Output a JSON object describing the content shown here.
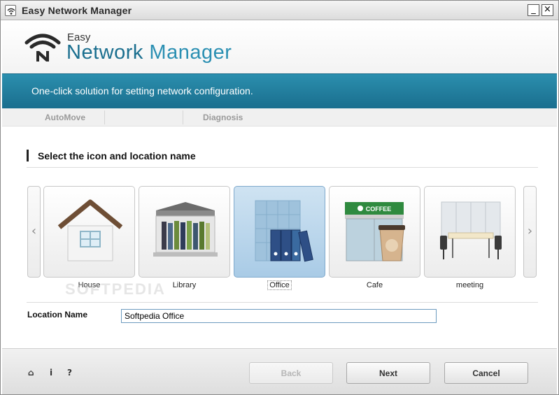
{
  "window": {
    "title": "Easy Network Manager",
    "minimize_glyph": "_",
    "close_glyph": "×",
    "icon": "wifi-icon"
  },
  "header": {
    "logo_small": "Easy",
    "logo_big_1": "Network",
    "logo_big_2": "Manager"
  },
  "banner": {
    "text": "One-click solution for setting network configuration."
  },
  "tabs": [
    {
      "label": "AutoMove"
    },
    {
      "label": "Diagnosis"
    }
  ],
  "section": {
    "title": "Select the icon and location name"
  },
  "carousel": {
    "prev_glyph": "‹",
    "next_glyph": "›",
    "tiles": [
      {
        "label": "House",
        "icon": "house-icon",
        "selected": false
      },
      {
        "label": "Library",
        "icon": "library-icon",
        "selected": false
      },
      {
        "label": "Office",
        "icon": "office-icon",
        "selected": true
      },
      {
        "label": "Cafe",
        "icon": "cafe-icon",
        "selected": false
      },
      {
        "label": "meeting",
        "icon": "meeting-icon",
        "selected": false
      }
    ],
    "cafe_sign": "COFFEE"
  },
  "location": {
    "label": "Location Name",
    "value": "Softpedia Office"
  },
  "footer": {
    "home_glyph": "⌂",
    "info_glyph": "i",
    "help_glyph": "?",
    "back_label": "Back",
    "next_label": "Next",
    "cancel_label": "Cancel"
  },
  "watermark": "SOFTPEDIA",
  "colors": {
    "accent": "#2a8fb2",
    "banner": "#1f7898",
    "selected_tile": "#b9d6ec"
  }
}
